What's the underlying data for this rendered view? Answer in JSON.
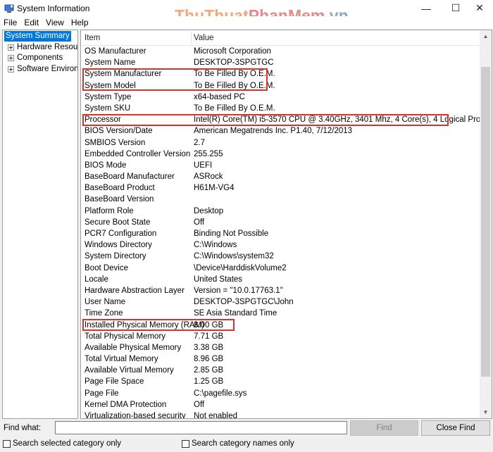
{
  "window": {
    "title": "System Information",
    "minimize_glyph": "—",
    "maximize_glyph": "☐",
    "close_glyph": "✕"
  },
  "watermark": {
    "part1": "ThuThuat",
    "part2": "PhanMem",
    "part3": ".vn"
  },
  "menu": {
    "file": "File",
    "edit": "Edit",
    "view": "View",
    "help": "Help"
  },
  "tree": {
    "selected": "System Summary",
    "items": [
      "Hardware Resources",
      "Components",
      "Software Environment"
    ]
  },
  "list": {
    "columns": {
      "item": "Item",
      "value": "Value"
    },
    "rows": [
      {
        "item": "OS Manufacturer",
        "value": "Microsoft Corporation"
      },
      {
        "item": "System Name",
        "value": "DESKTOP-3SPGTGC"
      },
      {
        "item": "System Manufacturer",
        "value": "To Be Filled By O.E.M."
      },
      {
        "item": "System Model",
        "value": "To Be Filled By O.E.M."
      },
      {
        "item": "System Type",
        "value": "x64-based PC"
      },
      {
        "item": "System SKU",
        "value": "To Be Filled By O.E.M."
      },
      {
        "item": "Processor",
        "value": "Intel(R) Core(TM) i5-3570 CPU @ 3.40GHz, 3401 Mhz, 4 Core(s), 4 Logical Pro..."
      },
      {
        "item": "BIOS Version/Date",
        "value": "American Megatrends Inc. P1.40, 7/12/2013"
      },
      {
        "item": "SMBIOS Version",
        "value": "2.7"
      },
      {
        "item": "Embedded Controller Version",
        "value": "255.255"
      },
      {
        "item": "BIOS Mode",
        "value": "UEFI"
      },
      {
        "item": "BaseBoard Manufacturer",
        "value": "ASRock"
      },
      {
        "item": "BaseBoard Product",
        "value": "H61M-VG4"
      },
      {
        "item": "BaseBoard Version",
        "value": ""
      },
      {
        "item": "Platform Role",
        "value": "Desktop"
      },
      {
        "item": "Secure Boot State",
        "value": "Off"
      },
      {
        "item": "PCR7 Configuration",
        "value": "Binding Not Possible"
      },
      {
        "item": "Windows Directory",
        "value": "C:\\Windows"
      },
      {
        "item": "System Directory",
        "value": "C:\\Windows\\system32"
      },
      {
        "item": "Boot Device",
        "value": "\\Device\\HarddiskVolume2"
      },
      {
        "item": "Locale",
        "value": "United States"
      },
      {
        "item": "Hardware Abstraction Layer",
        "value": "Version = \"10.0.17763.1\""
      },
      {
        "item": "User Name",
        "value": "DESKTOP-3SPGTGC\\John"
      },
      {
        "item": "Time Zone",
        "value": "SE Asia Standard Time"
      },
      {
        "item": "Installed Physical Memory (RAM)",
        "value": "8.00 GB"
      },
      {
        "item": "Total Physical Memory",
        "value": "7.71 GB"
      },
      {
        "item": "Available Physical Memory",
        "value": "3.38 GB"
      },
      {
        "item": "Total Virtual Memory",
        "value": "8.96 GB"
      },
      {
        "item": "Available Virtual Memory",
        "value": "2.85 GB"
      },
      {
        "item": "Page File Space",
        "value": "1.25 GB"
      },
      {
        "item": "Page File",
        "value": "C:\\pagefile.sys"
      },
      {
        "item": "Kernel DMA Protection",
        "value": "Off"
      },
      {
        "item": "Virtualization-based security",
        "value": "Not enabled"
      }
    ]
  },
  "find": {
    "label": "Find what:",
    "value": "",
    "find_button": "Find",
    "close_button": "Close Find",
    "search_selected_label": "Search selected category only",
    "search_names_label": "Search category names only"
  },
  "colors": {
    "selection": "#0078d7",
    "highlight_box": "#d9342b"
  }
}
